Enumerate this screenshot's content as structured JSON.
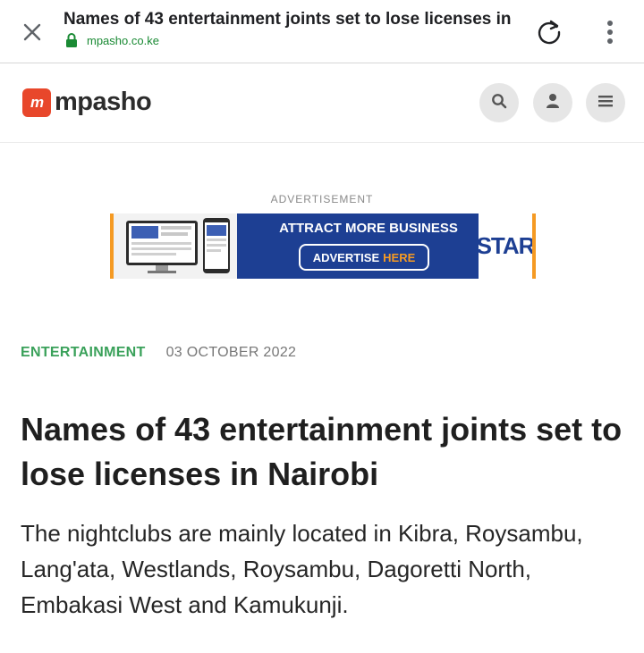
{
  "browser": {
    "page_title": "Names of 43 entertainment joints set to lose licenses in",
    "url": "mpasho.co.ke",
    "close_icon": "close-icon",
    "reload_icon": "reload-icon",
    "more_icon": "more-vert-icon",
    "lock_icon": "lock-icon",
    "secure_color": "#1a8a34"
  },
  "site_header": {
    "logo_badge": "m",
    "logo_text": "mpasho",
    "brand_color": "#e8472b",
    "buttons": [
      "search-icon",
      "user-icon",
      "menu-icon"
    ]
  },
  "ad": {
    "label": "ADVERTISEMENT",
    "headline": "ATTRACT MORE BUSINESS",
    "cta_text": "ADVERTISE",
    "cta_highlight": "HERE",
    "logo": "STAR",
    "banner_color": "#1d3f93",
    "accent_color": "#f59a23"
  },
  "article": {
    "category": "ENTERTAINMENT",
    "date": "03 OCTOBER 2022",
    "headline": "Names of 43 entertainment joints set to lose licenses in Nairobi",
    "lede": "The nightclubs are mainly located in Kibra, Roysambu, Lang'ata, Westlands, Roysambu, Dagoretti North, Embakasi West and Kamukunji.",
    "category_color": "#3aa15a"
  }
}
